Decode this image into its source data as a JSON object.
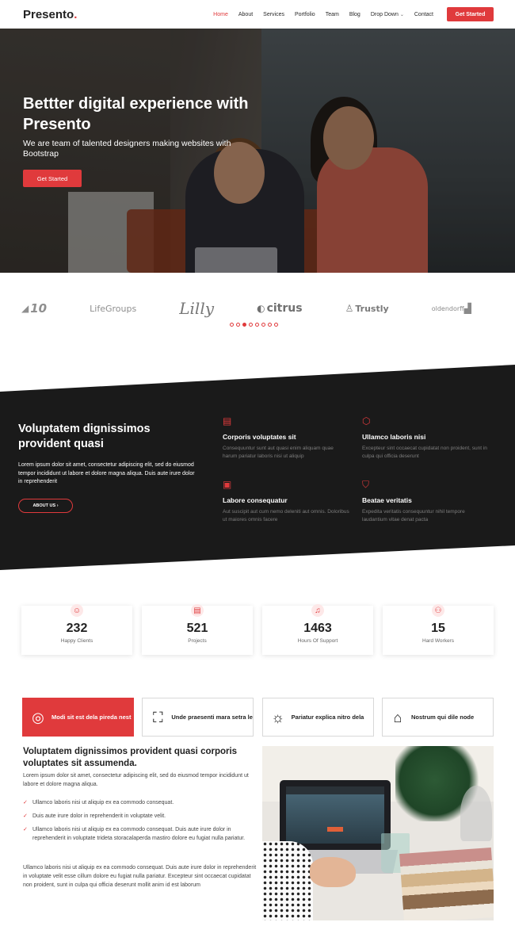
{
  "header": {
    "logo_text": "Presento",
    "logo_dot": ".",
    "nav": [
      {
        "label": "Home",
        "active": true
      },
      {
        "label": "About"
      },
      {
        "label": "Services"
      },
      {
        "label": "Portfolio"
      },
      {
        "label": "Team"
      },
      {
        "label": "Blog"
      },
      {
        "label": "Drop Down"
      },
      {
        "label": "Contact"
      }
    ],
    "cta": "Get Started"
  },
  "hero": {
    "title": "Bettter digital experience with Presento",
    "subtitle": "We are team of talented designers making websites with Bootstrap",
    "button": "Get Started"
  },
  "clients": {
    "logos": [
      "10",
      "LifeGroups",
      "Lilly",
      "citrus",
      "Trustly",
      "oldendorff"
    ],
    "active_dot": 3,
    "dot_count": 8
  },
  "features": {
    "title": "Voluptatem dignissimos provident quasi",
    "text": "Lorem ipsum dolor sit amet, consectetur adipiscing elit, sed do eiusmod tempor incididunt ut labore et dolore magna aliqua. Duis aute irure dolor in reprehenderit",
    "button": "ABOUT US",
    "items": [
      {
        "icon": "document-icon",
        "title": "Corporis voluptates sit",
        "text": "Consequuntur sunt aut quasi enim aliquam quae harum pariatur laboris nisi ut aliquip"
      },
      {
        "icon": "cube-icon",
        "title": "Ullamco laboris nisi",
        "text": "Excepteur sint occaecat cupidatat non proident, sunt in culpa qui officia deserunt"
      },
      {
        "icon": "images-icon",
        "title": "Labore consequatur",
        "text": "Aut suscipit aut cum nemo deleniti aut omnis. Doloribus ut maiores omnis facere"
      },
      {
        "icon": "shield-icon",
        "title": "Beatae veritatis",
        "text": "Expedita veritatis consequuntur nihil tempore laudantium vitae denat pacta"
      }
    ]
  },
  "stats": [
    {
      "icon": "smile-icon",
      "number": "232",
      "label": "Happy Clients"
    },
    {
      "icon": "journal-icon",
      "number": "521",
      "label": "Projects"
    },
    {
      "icon": "headset-icon",
      "number": "1463",
      "label": "Hours Of Support"
    },
    {
      "icon": "people-icon",
      "number": "15",
      "label": "Hard Workers"
    }
  ],
  "tabs": [
    {
      "icon": "broadcast-icon",
      "label": "Modi sit est dela pireda nest",
      "active": true
    },
    {
      "icon": "focus-icon",
      "label": "Unde praesenti mara setra le"
    },
    {
      "icon": "sun-icon",
      "label": "Pariatur explica nitro dela"
    },
    {
      "icon": "store-icon",
      "label": "Nostrum qui dile node"
    }
  ],
  "content": {
    "title": "Voluptatem dignissimos provident quasi corporis voluptates sit assumenda.",
    "intro": "Lorem ipsum dolor sit amet, consectetur adipiscing elit, sed do eiusmod tempor incididunt ut labore et dolore magna aliqua.",
    "bullets": [
      "Ullamco laboris nisi ut aliquip ex ea commodo consequat.",
      "Duis aute irure dolor in reprehenderit in voluptate velit.",
      "Ullamco laboris nisi ut aliquip ex ea commodo consequat. Duis aute irure dolor in reprehenderit in voluptate trideta storacalaperda mastiro dolore eu fugiat nulla pariatur."
    ],
    "outro": "Ullamco laboris nisi ut aliquip ex ea commodo consequat. Duis aute irure dolor in reprehenderit in voluptate velit esse cillum dolore eu fugiat nulla pariatur. Excepteur sint occaecat cupidatat non proident, sunt in culpa qui officia deserunt mollit anim id est laborum"
  },
  "colors": {
    "accent": "#e03a3c",
    "dark": "#1a1a1a"
  }
}
